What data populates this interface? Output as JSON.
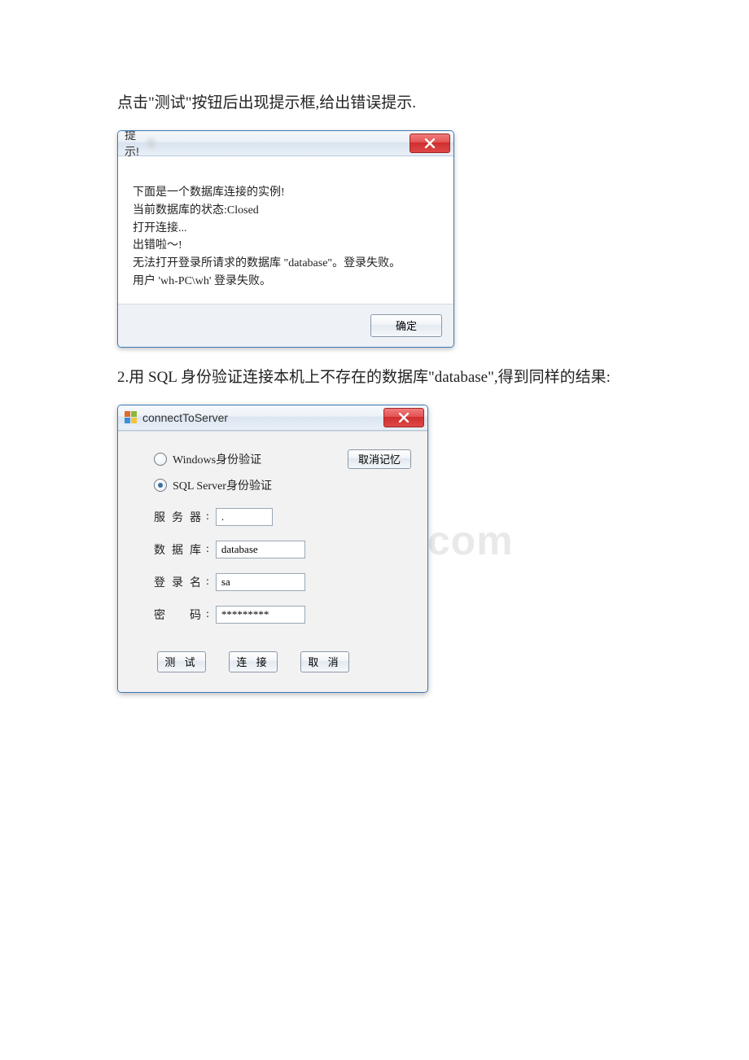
{
  "text": {
    "para1": "点击\"测试\"按钮后出现提示框,给出错误提示.",
    "para2": "2.用 SQL 身份验证连接本机上不存在的数据库\"database\",得到同样的结果:"
  },
  "watermark": "www.bdocx.com",
  "dialog1": {
    "title": "提示!",
    "lines": {
      "l1": "下面是一个数据库连接的实例!",
      "l2": "当前数据库的状态:Closed",
      "l3": "打开连接...",
      "l4": "出错啦～!",
      "l5": "无法打开登录所请求的数据库 \"database\"。登录失败。",
      "l6": "用户 'wh-PC\\wh' 登录失败。"
    },
    "ok": "确定"
  },
  "dialog2": {
    "title": "connectToServer",
    "radio_windows": "Windows身份验证",
    "radio_sql": "SQL Server身份验证",
    "clear_btn": "取消记忆",
    "labels": {
      "server": "服务器",
      "database": "数据库",
      "login": "登录名",
      "password": "密  码"
    },
    "values": {
      "server": ".",
      "database": "database",
      "login": "sa",
      "password": "*********"
    },
    "buttons": {
      "test": "测 试",
      "connect": "连 接",
      "cancel": "取 消"
    }
  }
}
